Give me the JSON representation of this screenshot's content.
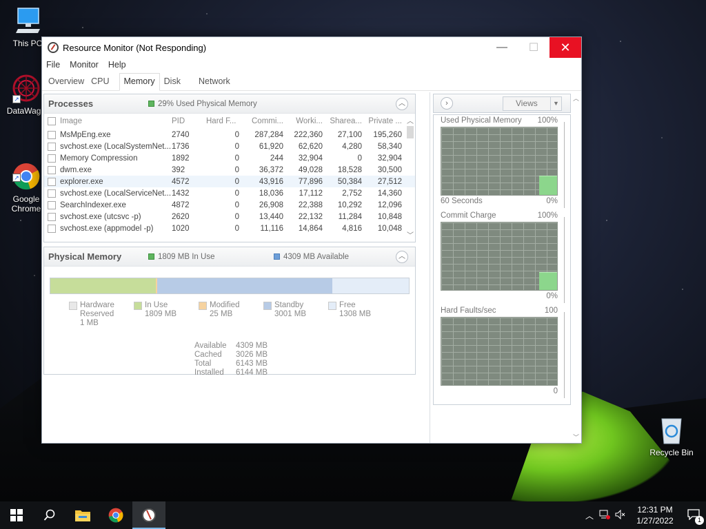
{
  "desktop": {
    "icons": [
      {
        "label": "This PC"
      },
      {
        "label": "DataWago"
      },
      {
        "label": "Google\nChrome"
      },
      {
        "label": "Recycle Bin"
      }
    ]
  },
  "window": {
    "title": "Resource Monitor (Not Responding)",
    "menu": [
      "File",
      "Monitor",
      "Help"
    ],
    "tabs": [
      "Overview",
      "CPU",
      "Memory",
      "Disk",
      "Network"
    ],
    "active_tab": "Memory"
  },
  "processes": {
    "title": "Processes",
    "info": "29% Used Physical Memory",
    "columns": [
      "Image",
      "PID",
      "Hard F...",
      "Commi...",
      "Worki...",
      "Sharea...",
      "Private ..."
    ],
    "rows": [
      [
        "MsMpEng.exe",
        "2740",
        "0",
        "287,284",
        "222,360",
        "27,100",
        "195,260"
      ],
      [
        "svchost.exe (LocalSystemNet...",
        "1736",
        "0",
        "61,920",
        "62,620",
        "4,280",
        "58,340"
      ],
      [
        "Memory Compression",
        "1892",
        "0",
        "244",
        "32,904",
        "0",
        "32,904"
      ],
      [
        "dwm.exe",
        "392",
        "0",
        "36,372",
        "49,028",
        "18,528",
        "30,500"
      ],
      [
        "explorer.exe",
        "4572",
        "0",
        "43,916",
        "77,896",
        "50,384",
        "27,512"
      ],
      [
        "svchost.exe (LocalServiceNet...",
        "1432",
        "0",
        "18,036",
        "17,112",
        "2,752",
        "14,360"
      ],
      [
        "SearchIndexer.exe",
        "4872",
        "0",
        "26,908",
        "22,388",
        "10,292",
        "12,096"
      ],
      [
        "svchost.exe (utcsvc -p)",
        "2620",
        "0",
        "13,440",
        "22,132",
        "11,284",
        "10,848"
      ],
      [
        "svchost.exe (appmodel -p)",
        "1020",
        "0",
        "11,116",
        "14,864",
        "4,816",
        "10,048"
      ]
    ],
    "selected_row": 4
  },
  "physical_memory": {
    "title": "Physical Memory",
    "in_use": "1809 MB In Use",
    "available": "4309 MB Available",
    "bar_fractions": {
      "hardware_reserved": 0.0002,
      "in_use": 0.2945,
      "modified": 0.004,
      "standby": 0.4886,
      "free": 0.2127
    },
    "legend": [
      {
        "name": "Hardware\nReserved",
        "value": "1 MB",
        "color": "#e8e8e8"
      },
      {
        "name": "In Use",
        "value": "1809 MB",
        "color": "#c6dd9a"
      },
      {
        "name": "Modified",
        "value": "25 MB",
        "color": "#f6d3a0"
      },
      {
        "name": "Standby",
        "value": "3001 MB",
        "color": "#b7cbe6"
      },
      {
        "name": "Free",
        "value": "1308 MB",
        "color": "#e4edf8"
      }
    ],
    "summary": [
      {
        "key": "Available",
        "value": "4309 MB"
      },
      {
        "key": "Cached",
        "value": "3026 MB"
      },
      {
        "key": "Total",
        "value": "6143 MB"
      },
      {
        "key": "Installed",
        "value": "6144 MB"
      }
    ]
  },
  "graphs": {
    "views_label": "Views",
    "items": [
      {
        "title": "Used Physical Memory",
        "max": "100%",
        "footer_left": "60 Seconds",
        "footer_right": "0%",
        "fill": 0.29
      },
      {
        "title": "Commit Charge",
        "max": "100%",
        "footer_left": "",
        "footer_right": "0%",
        "fill": 0.27
      },
      {
        "title": "Hard Faults/sec",
        "max": "100",
        "footer_left": "",
        "footer_right": "0",
        "fill": 0
      }
    ]
  },
  "taskbar": {
    "time": "12:31 PM",
    "date": "1/27/2022",
    "notification_count": "1"
  },
  "colors": {
    "close_button": "#e81123",
    "graph_bg": "#7f8a7f",
    "graph_fill": "#8cd68c",
    "used_memory_legend": "#5fb55f"
  }
}
